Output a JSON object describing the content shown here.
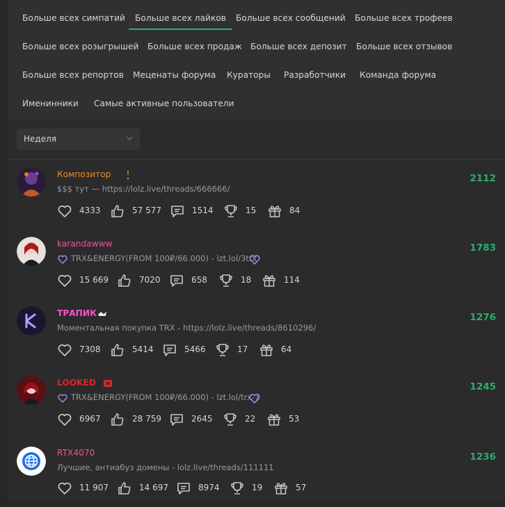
{
  "tabs": [
    {
      "label": "Больше всех симпатий"
    },
    {
      "label": "Больше всех лайков"
    },
    {
      "label": "Больше всех сообщений"
    },
    {
      "label": "Больше всех трофеев"
    },
    {
      "label": "Больше всех розыгрышей"
    },
    {
      "label": "Больше всех продаж"
    },
    {
      "label": "Больше всех депозит"
    },
    {
      "label": "Больше всех отзывов"
    },
    {
      "label": "Больше всех репортов"
    },
    {
      "label": "Меценаты форума"
    },
    {
      "label": "Кураторы"
    },
    {
      "label": "Разработчики"
    },
    {
      "label": "Команда форума"
    },
    {
      "label": "Именинники"
    },
    {
      "label": "Самые активные пользователи"
    }
  ],
  "active_tab": "Больше всех лайков",
  "period_select": {
    "value": "Неделя"
  },
  "colors": {
    "accent": "#2bad72",
    "status_text": "#9a9a9a"
  },
  "users": [
    {
      "name": "Композитор",
      "name_color": "#f28b1e",
      "status": "$$$ тут — https://lolz.live/threads/666666/",
      "likes": "4333",
      "thumbs": "57 577",
      "messages": "1514",
      "trophies": "15",
      "gifts": "84",
      "score": "2112"
    },
    {
      "name": "karandawww",
      "name_color": "#f0519c",
      "status": "TRX&ENERGY(FROM 100₽/66.000) - lzt.lol/3trx",
      "likes": "15 669",
      "thumbs": "7020",
      "messages": "658",
      "trophies": "18",
      "gifts": "114",
      "score": "1783"
    },
    {
      "name": "ТРАПИК",
      "name_color": "#ff4fc8",
      "status": "Моментальная покупка TRX - https://lolz.live/threads/8610296/",
      "likes": "7308",
      "thumbs": "5414",
      "messages": "5466",
      "trophies": "17",
      "gifts": "64",
      "score": "1276"
    },
    {
      "name": "LOOKED",
      "name_color": "#e0242c",
      "status": "TRX&ENERGY(FROM 100₽/66.000) - lzt.lol/trx-7",
      "likes": "6967",
      "thumbs": "28 759",
      "messages": "2645",
      "trophies": "22",
      "gifts": "53",
      "score": "1245"
    },
    {
      "name": "RTX4070",
      "name_color": "#f0519c",
      "status": "Лучшие, антиабуз домены - lolz.live/threads/111111",
      "likes": "11 907",
      "thumbs": "14 697",
      "messages": "8974",
      "trophies": "19",
      "gifts": "57",
      "score": "1236"
    }
  ]
}
